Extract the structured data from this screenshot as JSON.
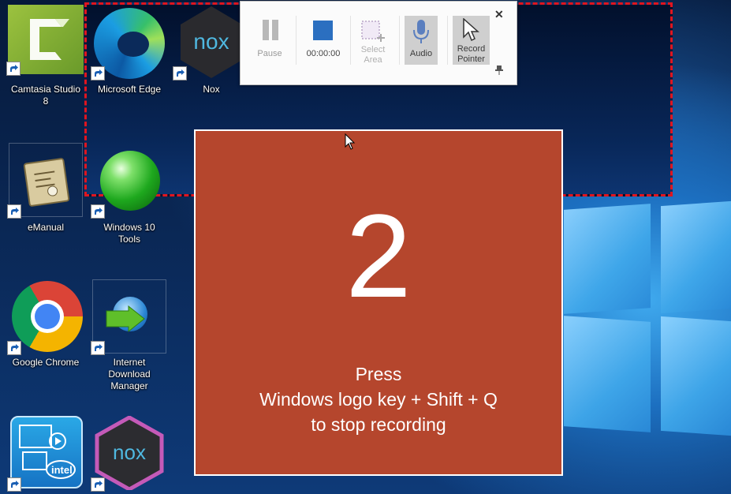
{
  "desktop": {
    "icons": [
      {
        "label": "Camtasia Studio 8"
      },
      {
        "label": "Microsoft Edge"
      },
      {
        "label": "Nox"
      },
      {
        "label": "eManual"
      },
      {
        "label": "Windows 10 Tools"
      },
      {
        "label": "Google Chrome"
      },
      {
        "label": "Internet Download Manager"
      },
      {
        "label": ""
      },
      {
        "label": ""
      }
    ]
  },
  "recorder": {
    "pause_label": "Pause",
    "timer": "00:00:00",
    "select_area_label": "Select Area",
    "audio_label": "Audio",
    "record_pointer_label": "Record Pointer",
    "close_glyph": "✕",
    "pin_glyph": "📌"
  },
  "countdown": {
    "number": "2",
    "line1": "Press",
    "line2": "Windows logo key + Shift + Q",
    "line3": "to stop recording"
  },
  "colors": {
    "countdown_bg": "#b5462d",
    "capture_border": "#e0151f",
    "active_toggle": "#cfcfcf"
  }
}
